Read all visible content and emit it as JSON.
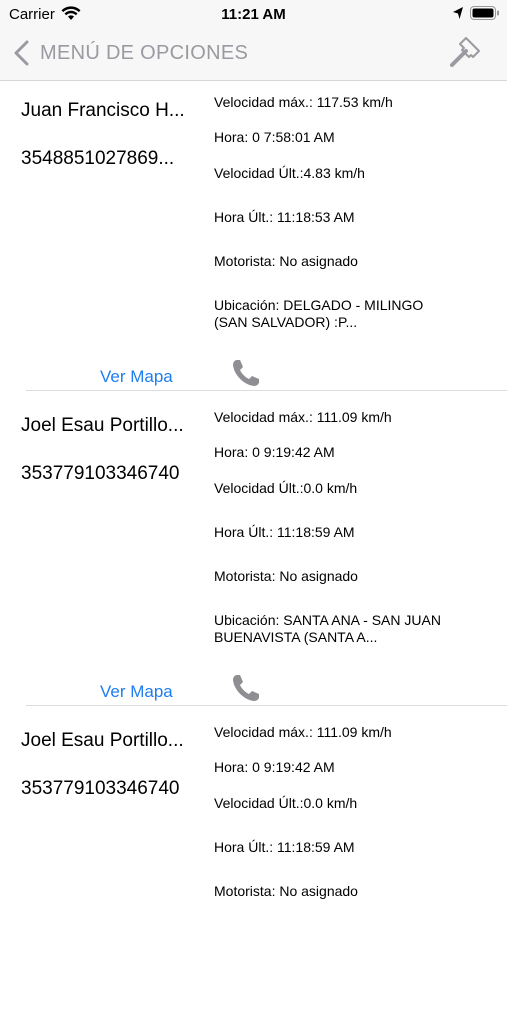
{
  "status_bar": {
    "carrier": "Carrier",
    "time": "11:21 AM"
  },
  "nav": {
    "back_label": "MENÚ DE OPCIONES",
    "accent": "#1e7ef0"
  },
  "vehicles": [
    {
      "name": "Juan Francisco H...",
      "imei": "3548851027869...",
      "vel_max": "Velocidad máx.: 117.53 km/h",
      "hora": "Hora: 0 7:58:01 AM",
      "vel_ult": "Velocidad Últ.:4.83 km/h",
      "hora_ult": "Hora Últ.: 11:18:53 AM",
      "motorista": "Motorista: No asignado",
      "ubicacion": "Ubicación: DELGADO - MILINGO (SAN SALVADOR) :P...",
      "ver_mapa": "Ver Mapa"
    },
    {
      "name": "Joel Esau Portillo...",
      "imei": "353779103346740",
      "vel_max": "Velocidad máx.: 111.09 km/h",
      "hora": "Hora: 0 9:19:42 AM",
      "vel_ult": "Velocidad Últ.:0.0 km/h",
      "hora_ult": "Hora Últ.: 11:18:59 AM",
      "motorista": "Motorista: No asignado",
      "ubicacion": "Ubicación: SANTA ANA - SAN JUAN BUENAVISTA (SANTA A...",
      "ver_mapa": "Ver Mapa"
    },
    {
      "name": "Joel Esau Portillo...",
      "imei": "353779103346740",
      "vel_max": "Velocidad máx.: 111.09 km/h",
      "hora": "Hora: 0 9:19:42 AM",
      "vel_ult": "Velocidad Últ.:0.0 km/h",
      "hora_ult": "Hora Últ.: 11:18:59 AM",
      "motorista": "Motorista: No asignado",
      "ubicacion": "",
      "ver_mapa": ""
    }
  ]
}
